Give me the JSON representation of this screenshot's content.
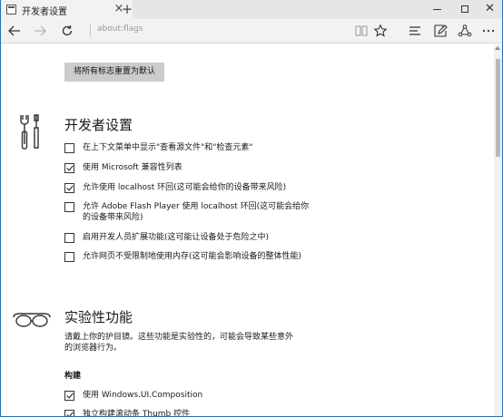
{
  "tab": {
    "title": "开发者设置",
    "close_glyph": "×",
    "new_tab_glyph": "+"
  },
  "window_controls": {
    "close_glyph": "✕"
  },
  "nav": {
    "address": "about:flags"
  },
  "reset_button": "将所有标志重置为默认",
  "developer": {
    "title": "开发者设置",
    "options": [
      {
        "label": "在上下文菜单中显示\"查看源文件\"和\"检查元素\"",
        "checked": false
      },
      {
        "label": "使用 Microsoft 兼容性列表",
        "checked": true
      },
      {
        "label": "允许使用 localhost 环回(这可能会给你的设备带来风险)",
        "checked": true
      },
      {
        "label": "允许 Adobe Flash Player 使用 localhost 环回(这可能会给你的设备带来风险)",
        "checked": false
      },
      {
        "label": "启用开发人员扩展功能(这可能让设备处于危险之中)",
        "checked": false
      },
      {
        "label": "允许网页不受限制地使用内存(这可能会影响设备的整体性能)",
        "checked": false
      }
    ]
  },
  "experimental": {
    "title": "实验性功能",
    "description": "请戴上你的护目镜。这些功能是实验性的，可能会导致某些意外的浏览器行为。",
    "subheading": "构建",
    "options": [
      {
        "label": "使用 Windows.UI.Composition",
        "checked": true
      },
      {
        "label": "独立构建滚动条 Thumb 控件",
        "checked": true
      }
    ]
  }
}
